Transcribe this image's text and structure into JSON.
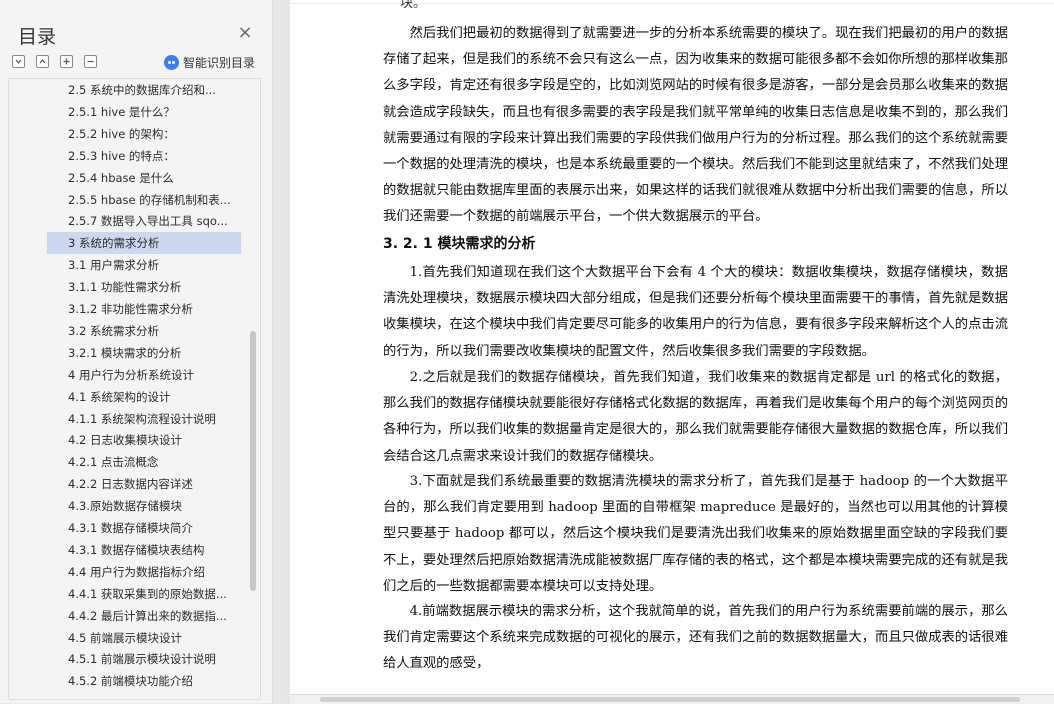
{
  "sidebar": {
    "title": "目录",
    "close_symbol": "×",
    "tools": [
      "expand-all",
      "collapse-up",
      "add-level",
      "remove-level"
    ],
    "smart_toc_label": "智能识别目录",
    "items": [
      {
        "label": "2.5  系统中的数据库介绍和...",
        "active": false
      },
      {
        "label": "2.5.1 hive 是什么？",
        "active": false
      },
      {
        "label": "2.5.2 hive 的架构：",
        "active": false
      },
      {
        "label": "2.5.3 hive 的特点：",
        "active": false
      },
      {
        "label": "2.5.4 hbase 是什么",
        "active": false
      },
      {
        "label": "2.5.5 hbase 的存储机制和表...",
        "active": false
      },
      {
        "label": "2.5.7  数据导入导出工具 sqo...",
        "active": false
      },
      {
        "label": "3  系统的需求分析",
        "active": true
      },
      {
        "label": "3.1  用户需求分析",
        "active": false
      },
      {
        "label": "3.1.1  功能性需求分析",
        "active": false
      },
      {
        "label": "3.1.2  非功能性需求分析",
        "active": false
      },
      {
        "label": "3.2  系统需求分析",
        "active": false
      },
      {
        "label": "3.2.1  模块需求的分析",
        "active": false
      },
      {
        "label": "4 用户行为分析系统设计",
        "active": false
      },
      {
        "label": "4.1  系统架构的设计",
        "active": false
      },
      {
        "label": "4.1.1  系统架构流程设计说明",
        "active": false
      },
      {
        "label": "4.2  日志收集模块设计",
        "active": false
      },
      {
        "label": "4.2.1  点击流概念",
        "active": false
      },
      {
        "label": "4.2.2  日志数据内容详述",
        "active": false
      },
      {
        "label": "4.3.原始数据存储模块",
        "active": false
      },
      {
        "label": "4.3.1 数据存储模块简介",
        "active": false
      },
      {
        "label": "4.3.1  数据存储模块表结构",
        "active": false
      },
      {
        "label": "4.4  用户行为数据指标介绍",
        "active": false
      },
      {
        "label": "4.4.1  获取采集到的原始数据...",
        "active": false
      },
      {
        "label": "4.4.2  最后计算出来的数据指...",
        "active": false
      },
      {
        "label": "4.5  前端展示模块设计",
        "active": false
      },
      {
        "label": "4.5.1  前端展示模块设计说明",
        "active": false
      },
      {
        "label": "4.5.2  前端模块功能介绍",
        "active": false
      }
    ]
  },
  "document": {
    "top_fragment": "块。",
    "paragraphs_before": [
      "然后我们把最初的数据得到了就需要进一步的分析本系统需要的模块了。现在我们把最初的用户的数据存储了起来，但是我们的系统不会只有这么一点，因为收集来的数据可能很多都不会如你所想的那样收集那么多字段，肯定还有很多字段是空的，比如浏览网站的时候有很多是游客，一部分是会员那么收集来的数据就会造成字段缺失，而且也有很多需要的表字段是我们就平常单纯的收集日志信息是收集不到的，那么我们就需要通过有限的字段来计算出我们需要的字段供我们做用户行为的分析过程。那么我们的这个系统就需要一个数据的处理清洗的模块，也是本系统最重要的一个模块。然后我们不能到这里就结束了，不然我们处理的数据就只能由数据库里面的表展示出来，如果这样的话我们就很难从数据中分析出我们需要的信息，所以我们还需要一个数据的前端展示平台，一个供大数据展示的平台。"
    ],
    "section_heading": "3. 2. 1  模块需求的分析",
    "paragraphs": [
      "1.首先我们知道现在我们这个大数据平台下会有 4 个大的模块：数据收集模块，数据存储模块，数据清洗处理模块，数据展示模块四大部分组成，但是我们还要分析每个模块里面需要干的事情，首先就是数据收集模块，在这个模块中我们肯定要尽可能多的收集用户的行为信息，要有很多字段来解析这个人的点击流的行为，所以我们需要改收集模块的配置文件，然后收集很多我们需要的字段数据。",
      "2.之后就是我们的数据存储模块，首先我们知道，我们收集来的数据肯定都是 url 的格式化的数据，那么我们的数据存储模块就要能很好存储格式化数据的数据库，再着我们是收集每个用户的每个浏览网页的各种行为，所以我们收集的数据量肯定是很大的，那么我们就需要能存储很大量数据的数据仓库，所以我们会结合这几点需求来设计我们的数据存储模块。",
      "3.下面就是我们系统最重要的数据清洗模块的需求分析了，首先我们是基于 hadoop 的一个大数据平台的，那么我们肯定要用到 hadoop 里面的自带框架 mapreduce 是最好的，当然也可以用其他的计算模型只要基于 hadoop 都可以，然后这个模块我们是要清洗出我们收集来的原始数据里面空缺的字段我们要不上，要处理然后把原始数据清洗成能被数据厂库存储的表的格式，这个都是本模块需要完成的还有就是我们之后的一些数据都需要本模块可以支持处理。",
      "4.前端数据展示模块的需求分析，这个我就简单的说，首先我们的用户行为系统需要前端的展示，那么我们肯定需要这个系统来完成数据的可视化的展示，还有我们之前的数据数据量大，而且只做成表的话很难给人直观的感受，"
    ]
  }
}
